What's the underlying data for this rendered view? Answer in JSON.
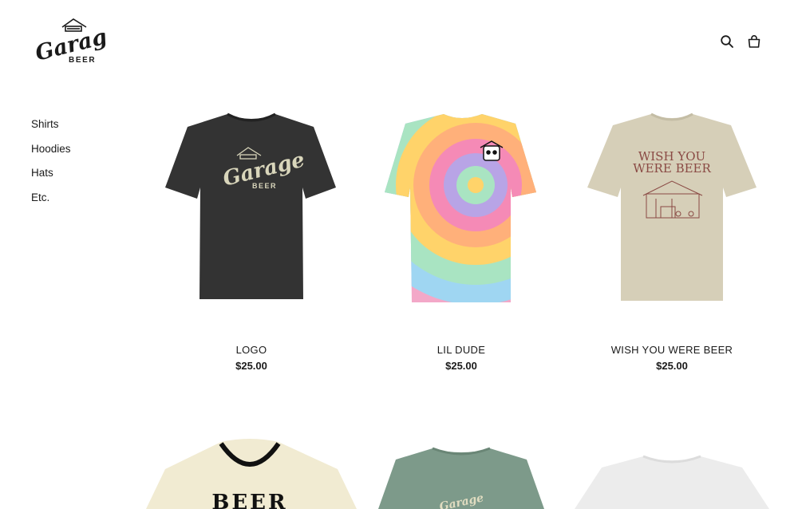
{
  "brand": {
    "logo_word": "Garage",
    "logo_sub": "BEER"
  },
  "header": {
    "icons": [
      "search-icon",
      "bag-icon"
    ]
  },
  "nav": {
    "items": [
      {
        "label": "Shirts"
      },
      {
        "label": "Hoodies"
      },
      {
        "label": "Hats"
      },
      {
        "label": "Etc."
      }
    ]
  },
  "products": [
    {
      "name": "LOGO",
      "price": "$25.00",
      "shirt_color": "#333333",
      "print_word": "Garage",
      "print_sub": "BEER"
    },
    {
      "name": "LIL DUDE",
      "price": "$25.00",
      "shirt_color": "tie-dye"
    },
    {
      "name": "WISH YOU WERE BEER",
      "price": "$25.00",
      "shirt_color": "#d6cfb8",
      "print_line1": "WISH YOU",
      "print_line2": "WERE BEER"
    }
  ],
  "products_row2": [
    {
      "shirt_color": "#f1ebd2",
      "collar_color": "#111111",
      "print_word": "BEER"
    },
    {
      "shirt_color": "#7d9a8a",
      "print_word": "Garage"
    },
    {
      "shirt_color": "#ececec"
    }
  ],
  "colors": {
    "text": "#1a1a1a",
    "background": "#ffffff"
  }
}
